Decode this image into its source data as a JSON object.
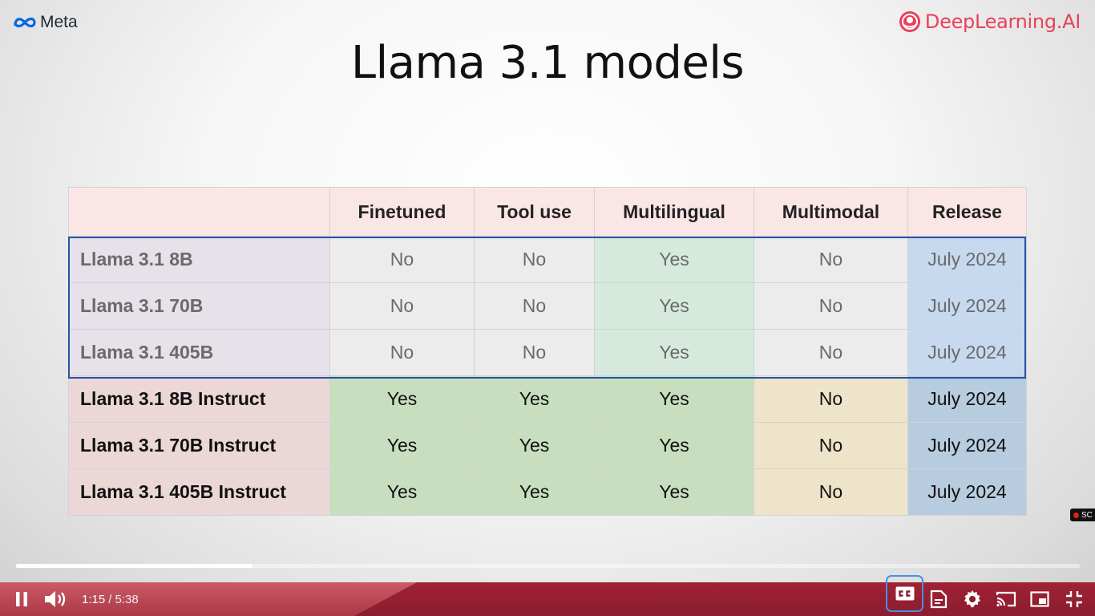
{
  "slide": {
    "meta_logo": "Meta",
    "dl_logo": "DeepLearning.AI",
    "title": "Llama 3.1 models",
    "headers": [
      "",
      "Finetuned",
      "Tool use",
      "Multilingual",
      "Multimodal",
      "Release"
    ],
    "rows": [
      {
        "name": "Llama 3.1 8B",
        "finetuned": "No",
        "tool_use": "No",
        "multilingual": "Yes",
        "multimodal": "No",
        "release": "July 2024"
      },
      {
        "name": "Llama 3.1 70B",
        "finetuned": "No",
        "tool_use": "No",
        "multilingual": "Yes",
        "multimodal": "No",
        "release": "July 2024"
      },
      {
        "name": "Llama 3.1 405B",
        "finetuned": "No",
        "tool_use": "No",
        "multilingual": "Yes",
        "multimodal": "No",
        "release": "July 2024"
      },
      {
        "name": "Llama 3.1 8B Instruct",
        "finetuned": "Yes",
        "tool_use": "Yes",
        "multilingual": "Yes",
        "multimodal": "No",
        "release": "July 2024"
      },
      {
        "name": "Llama 3.1 70B Instruct",
        "finetuned": "Yes",
        "tool_use": "Yes",
        "multilingual": "Yes",
        "multimodal": "No",
        "release": "July 2024"
      },
      {
        "name": "Llama 3.1 405B Instruct",
        "finetuned": "Yes",
        "tool_use": "Yes",
        "multilingual": "Yes",
        "multimodal": "No",
        "release": "July 2024"
      }
    ],
    "record_badge": "SC"
  },
  "player": {
    "current_time": "1:15",
    "duration": "/ 5:38",
    "progress_fraction": 0.222,
    "icons": [
      "pause-icon",
      "volume-icon",
      "subtitles-icon",
      "transcript-icon",
      "settings-icon",
      "cast-icon",
      "miniplayer-icon",
      "exit-fullscreen-icon"
    ]
  },
  "colors": {
    "accent_red": "#8a1d2e",
    "highlight_blue": "#2553a8",
    "dl_brand": "#e8415a"
  }
}
